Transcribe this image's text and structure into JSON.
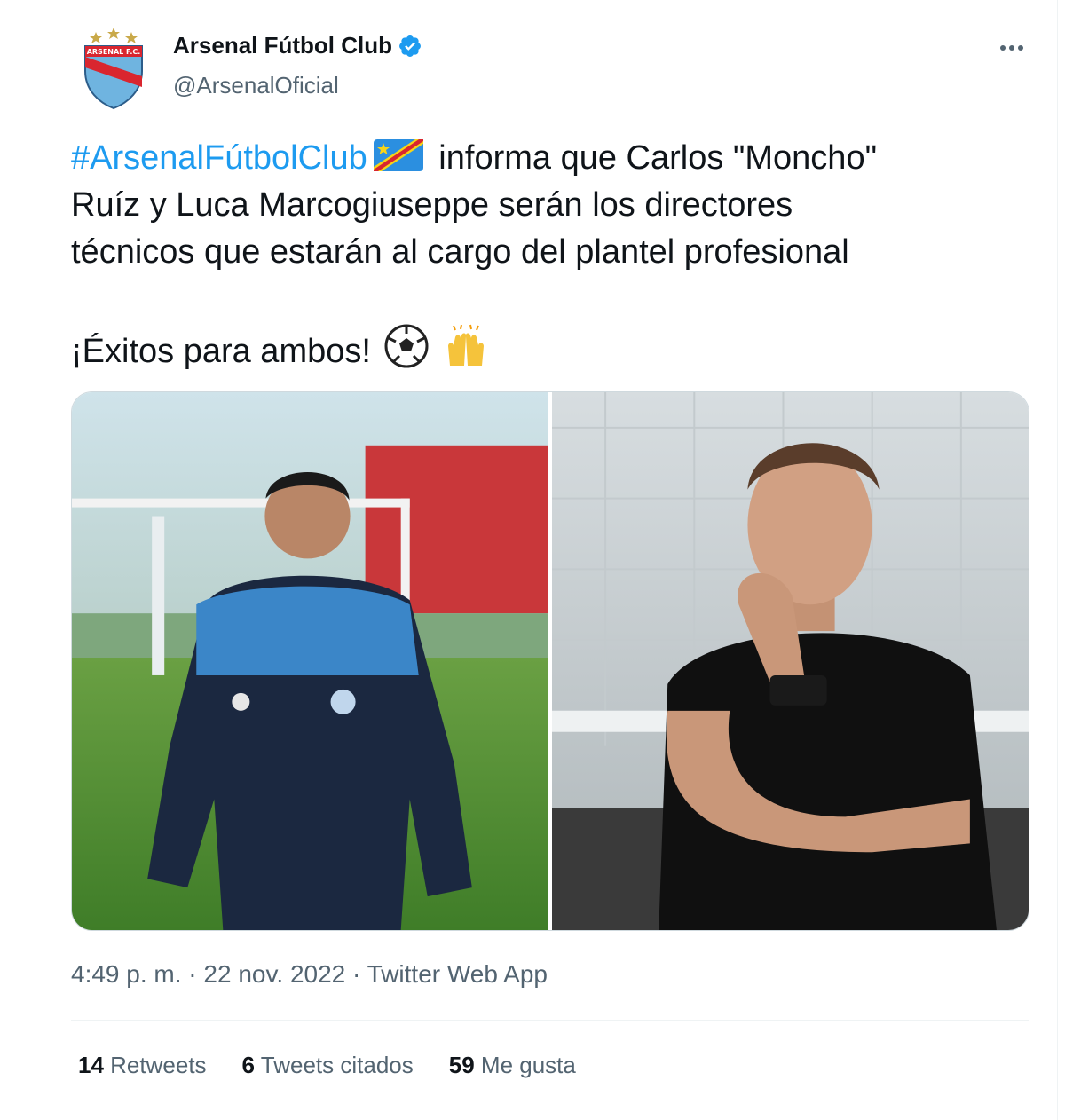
{
  "author": {
    "name": "Arsenal Fútbol Club",
    "handle": "@ArsenalOficial",
    "avatar_icon": "arsenal-crest-icon",
    "verified_icon": "verified-badge-icon"
  },
  "menu": {
    "more_icon": "more-options-icon"
  },
  "tweet": {
    "hashtag": "#ArsenalFútbolClub",
    "line1_rest": " informa que Carlos \"Moncho\"",
    "line2": "Ruíz y Luca Marcogiuseppe serán los directores",
    "line3": "técnicos que estarán al cargo del plantel profesional",
    "line4": "¡Éxitos para ambos!",
    "flag_icon": "flag-icon",
    "emoji_icons": [
      "soccer-ball-icon",
      "raising-hands-icon"
    ]
  },
  "media": {
    "photos": [
      "photo-coach-carlos-ruiz",
      "photo-coach-luca-marcogiuseppe"
    ]
  },
  "meta": {
    "time": "4:49 p. m.",
    "sep1": " · ",
    "date": "22 nov. 2022",
    "sep2": " · ",
    "app": "Twitter Web App"
  },
  "stats": {
    "retweets_count": "14",
    "retweets_label": "Retweets",
    "quotes_count": "6",
    "quotes_label": "Tweets citados",
    "likes_count": "59",
    "likes_label": "Me gusta"
  },
  "colors": {
    "accent": "#1d9bf0",
    "secondary_text": "#536471",
    "primary_text": "#0f1419"
  }
}
